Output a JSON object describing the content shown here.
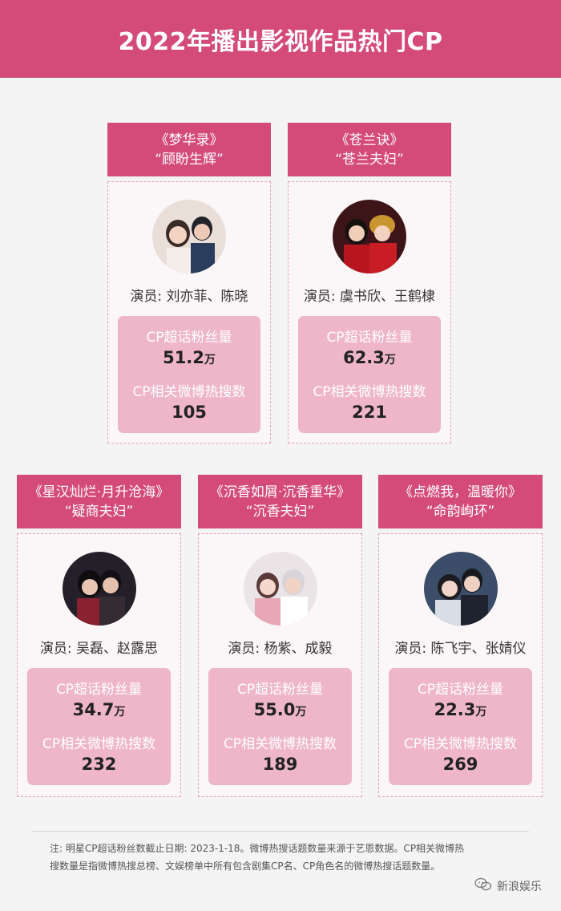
{
  "title": "2022年播出影视作品热门CP",
  "stat_labels": {
    "fans": "CP超话粉丝量",
    "searches": "CP相关微博热搜数"
  },
  "cards": [
    {
      "show": "《梦华录》",
      "cp": "“顾盼生辉”",
      "actors": "演员: 刘亦菲、陈晓",
      "fans": "51.2",
      "unit": "万",
      "searches": "105"
    },
    {
      "show": "《苍兰诀》",
      "cp": "“苍兰夫妇”",
      "actors": "演员: 虞书欣、王鹤棣",
      "fans": "62.3",
      "unit": "万",
      "searches": "221"
    },
    {
      "show": "《星汉灿烂·月升沧海》",
      "cp": "“疑商夫妇”",
      "actors": "演员: 吴磊、赵露思",
      "fans": "34.7",
      "unit": "万",
      "searches": "232"
    },
    {
      "show": "《沉香如屑·沉香重华》",
      "cp": "“沉香夫妇”",
      "actors": "演员: 杨紫、成毅",
      "fans": "55.0",
      "unit": "万",
      "searches": "189"
    },
    {
      "show": "《点燃我，温暖你》",
      "cp": "“命韵峋环”",
      "actors": "演员: 陈飞宇、张婧仪",
      "fans": "22.3",
      "unit": "万",
      "searches": "269"
    }
  ],
  "footnote_line1": "注: 明星CP超话粉丝数截止日期: 2023-1-18。微博热搜话题数量来源于艺恩数据。CP相关微博热",
  "footnote_line2": "搜数量是指微博热搜总榜、文娱榜单中所有包含剧集CP名、CP角色名的微博热搜话题数量。",
  "watermark": "新浪娱乐",
  "colors": {
    "accent": "#d44a78",
    "panel": "#eeb6c8"
  }
}
